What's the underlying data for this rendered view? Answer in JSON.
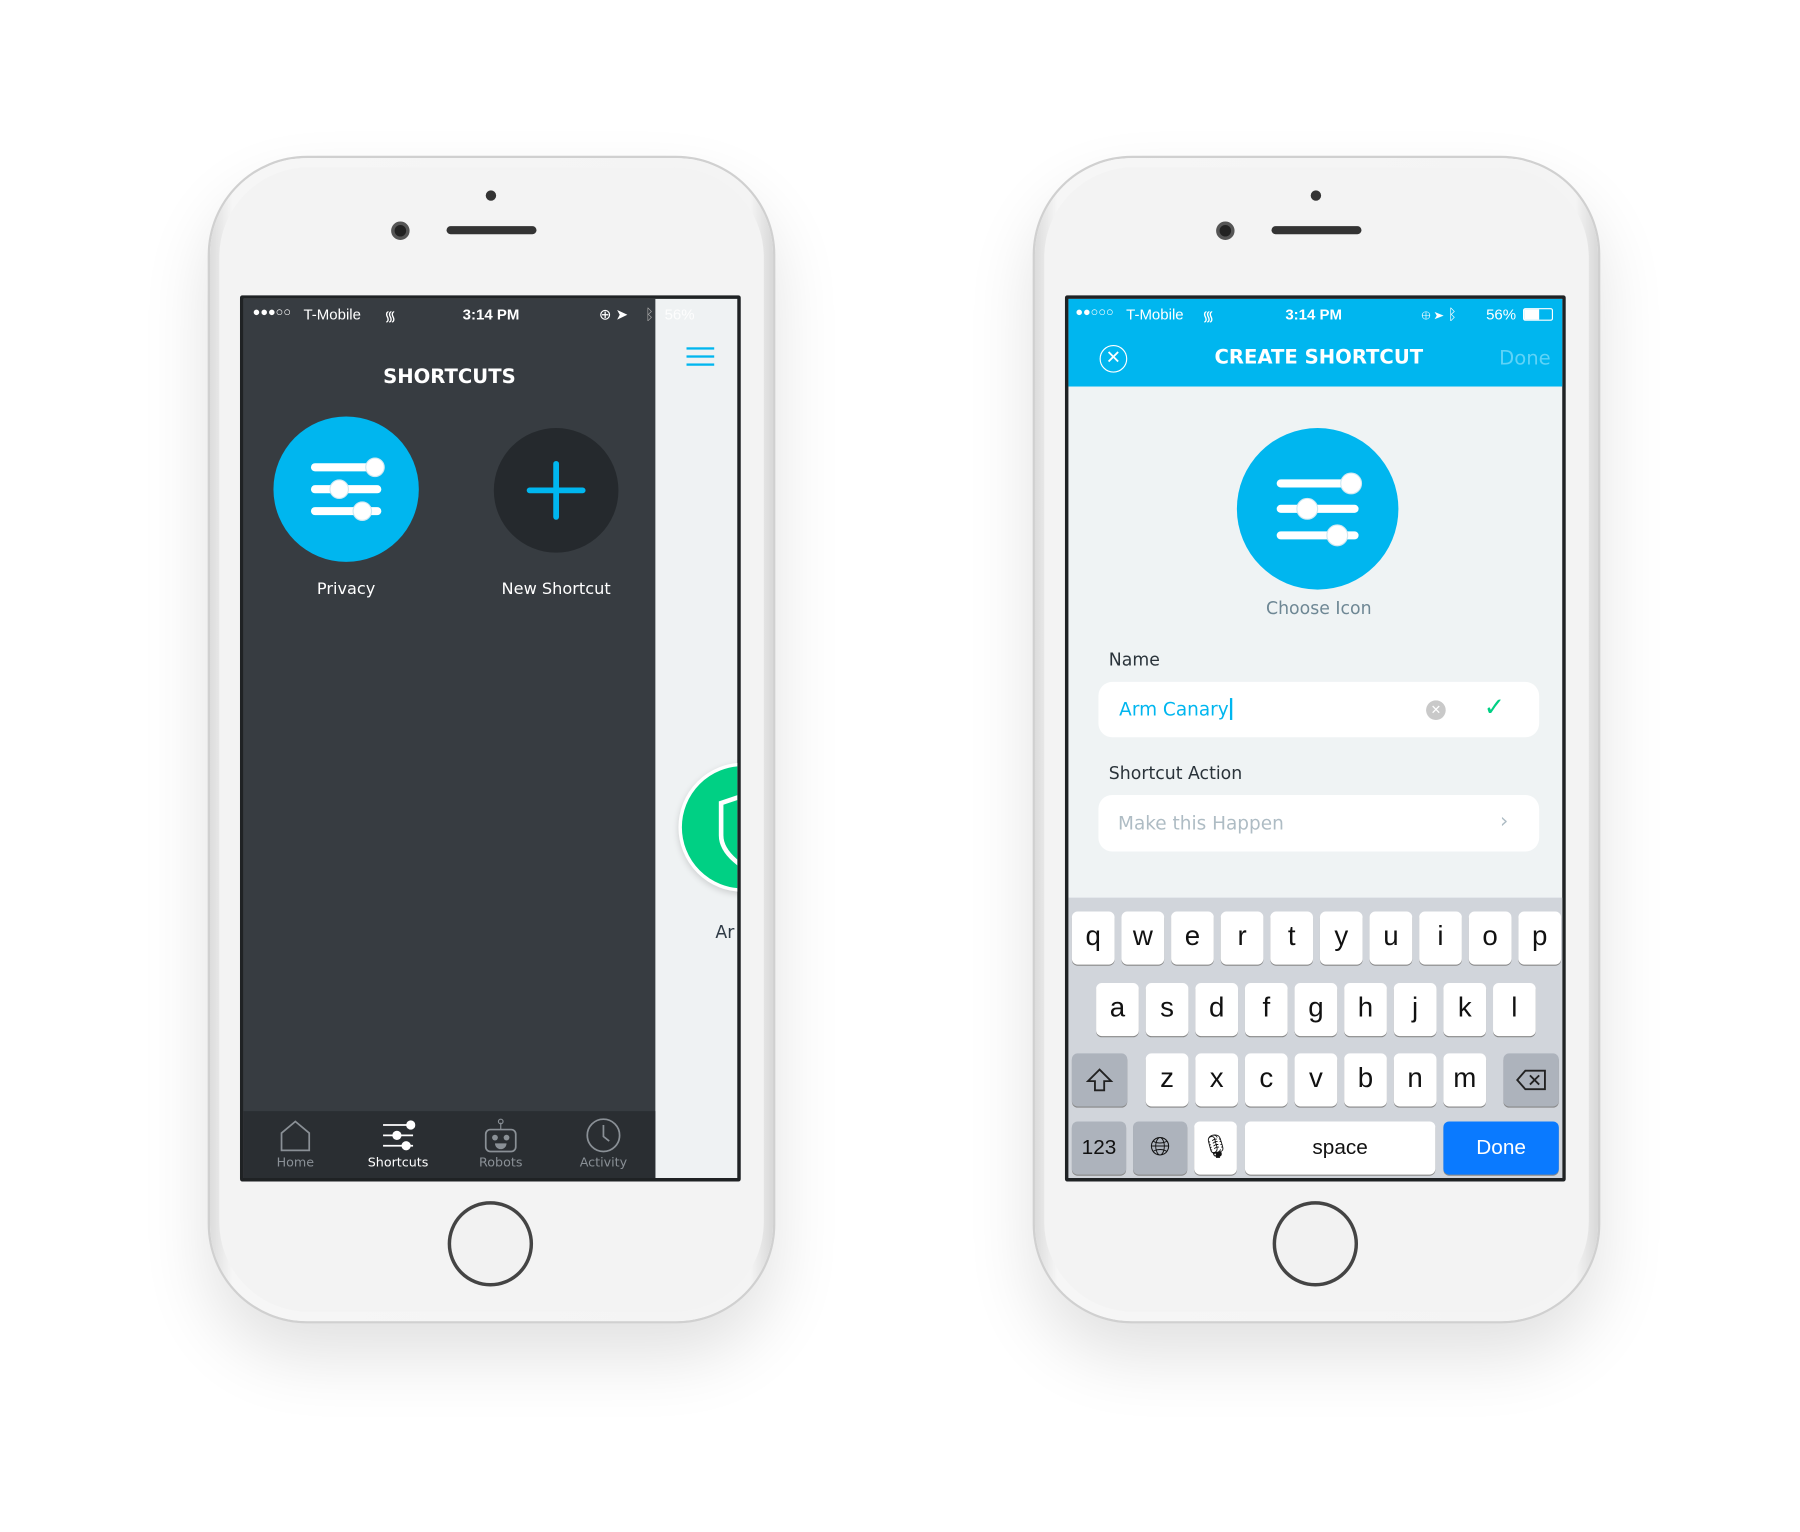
{
  "status_bar": {
    "carrier": "T-Mobile",
    "time": "3:14 PM",
    "battery": "56%",
    "signal_dots": "●●●○○",
    "signal_dots_right": "●●○○○"
  },
  "left": {
    "title": "SHORTCUTS",
    "shortcuts": [
      {
        "label": "Privacy",
        "icon": "sliders-icon"
      },
      {
        "label": "New Shortcut",
        "icon": "plus-icon"
      }
    ],
    "peek_label": "Ar",
    "tabs": [
      {
        "label": "Home",
        "icon": "home-icon"
      },
      {
        "label": "Shortcuts",
        "icon": "sliders-icon",
        "active": true
      },
      {
        "label": "Robots",
        "icon": "robot-icon"
      },
      {
        "label": "Activity",
        "icon": "clock-icon"
      }
    ]
  },
  "right": {
    "title": "CREATE SHORTCUT",
    "done_label": "Done",
    "choose_icon": "Choose Icon",
    "name_label": "Name",
    "name_value": "Arm Canary",
    "action_label": "Shortcut Action",
    "action_placeholder": "Make this Happen",
    "keyboard": {
      "row1": [
        "q",
        "w",
        "e",
        "r",
        "t",
        "y",
        "u",
        "i",
        "o",
        "p"
      ],
      "row2": [
        "a",
        "s",
        "d",
        "f",
        "g",
        "h",
        "j",
        "k",
        "l"
      ],
      "row3": [
        "z",
        "x",
        "c",
        "v",
        "b",
        "n",
        "m"
      ],
      "numbers": "123",
      "space": "space",
      "done": "Done"
    }
  },
  "colors": {
    "accent": "#00b6ef",
    "dark": "#373c41",
    "tabbar": "#2a2e32",
    "green": "#00d084",
    "keyboard_done": "#0a7aff"
  }
}
